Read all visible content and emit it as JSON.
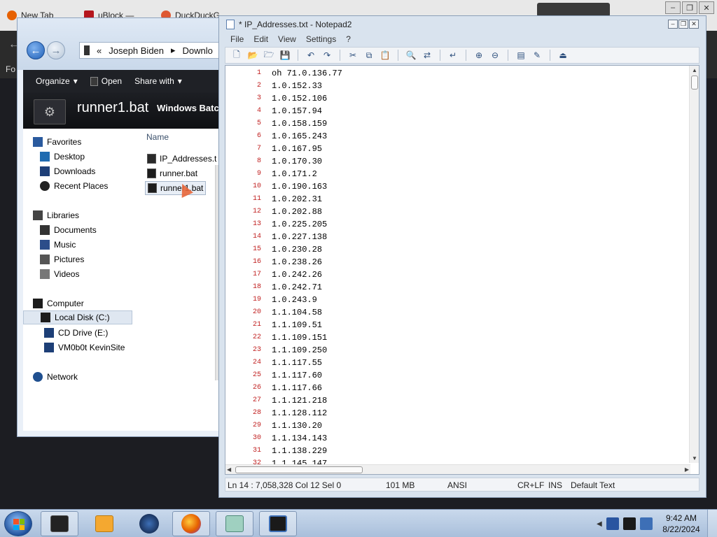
{
  "browser": {
    "tabs": [
      {
        "label": "New Tab",
        "color": "#e66000"
      },
      {
        "label": "uBlock — ",
        "color": "#b5161d"
      },
      {
        "label": "DuckDuckG",
        "color": "#de5833"
      }
    ],
    "partial_text": "Fo"
  },
  "explorer": {
    "breadcrumb": [
      "Joseph Biden",
      "Downlo"
    ],
    "toolbar": {
      "organize": "Organize",
      "open": "Open",
      "share_with": "Share with"
    },
    "details": {
      "file_name": "runner1.bat",
      "file_type": "Windows Batc"
    },
    "nav": {
      "favorites": "Favorites",
      "desktop": "Desktop",
      "downloads": "Downloads",
      "recent_places": "Recent Places",
      "libraries": "Libraries",
      "documents": "Documents",
      "music": "Music",
      "pictures": "Pictures",
      "videos": "Videos",
      "computer": "Computer",
      "local_disk": "Local Disk (C:)",
      "cd_drive": "CD Drive (E:)",
      "vm_share": "VM0b0t KevinSite",
      "network": "Network"
    },
    "files": {
      "column_name": "Name",
      "items": [
        "IP_Addresses.t",
        "runner.bat",
        "runner1.bat"
      ]
    }
  },
  "notepad": {
    "title": "* IP_Addresses.txt - Notepad2",
    "menu": [
      "File",
      "Edit",
      "View",
      "Settings",
      "?"
    ],
    "lines": [
      "oh 71.0.136.77",
      "1.0.152.33",
      "1.0.152.106",
      "1.0.157.94",
      "1.0.158.159",
      "1.0.165.243",
      "1.0.167.95",
      "1.0.170.30",
      "1.0.171.2",
      "1.0.190.163",
      "1.0.202.31",
      "1.0.202.88",
      "1.0.225.205",
      "1.0.227.138",
      "1.0.230.28",
      "1.0.238.26",
      "1.0.242.26",
      "1.0.242.71",
      "1.0.243.9",
      "1.1.104.58",
      "1.1.109.51",
      "1.1.109.151",
      "1.1.109.250",
      "1.1.117.55",
      "1.1.117.60",
      "1.1.117.66",
      "1.1.121.218",
      "1.1.128.112",
      "1.1.130.20",
      "1.1.134.143",
      "1.1.138.229",
      "1.1.145.147"
    ],
    "status": {
      "position": "Ln 14 : 7,058,328   Col 12   Sel 0",
      "size": "101 MB",
      "encoding": "ANSI",
      "line_ending": "CR+LF",
      "mode": "INS",
      "scheme": "Default Text"
    },
    "line_number_color": "#c02020"
  },
  "taskbar": {
    "clock_time": "9:42 AM",
    "clock_date": "8/22/2024"
  }
}
